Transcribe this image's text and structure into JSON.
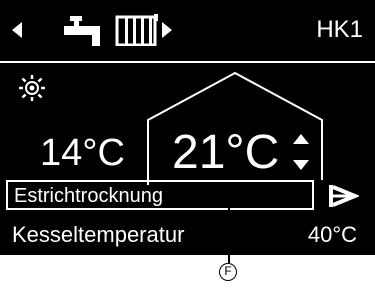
{
  "header": {
    "circuit_label": "HK1",
    "icons": [
      "arrow-left",
      "water-tap",
      "radiator",
      "arrow-right"
    ]
  },
  "main": {
    "weather_icon": "sun",
    "outside_temperature": "14°C",
    "room_temperature": "21°C",
    "adjust_icon": "up-down-arrows"
  },
  "program": {
    "label": "Estrichtrocknung",
    "mode_icon": "operating-mode"
  },
  "boiler": {
    "label": "Kesseltemperatur",
    "value": "40°C"
  },
  "callout": {
    "letter": "F"
  },
  "colors": {
    "display_background": "#000000",
    "display_foreground": "#ffffff",
    "page_background": "#ffffff"
  }
}
